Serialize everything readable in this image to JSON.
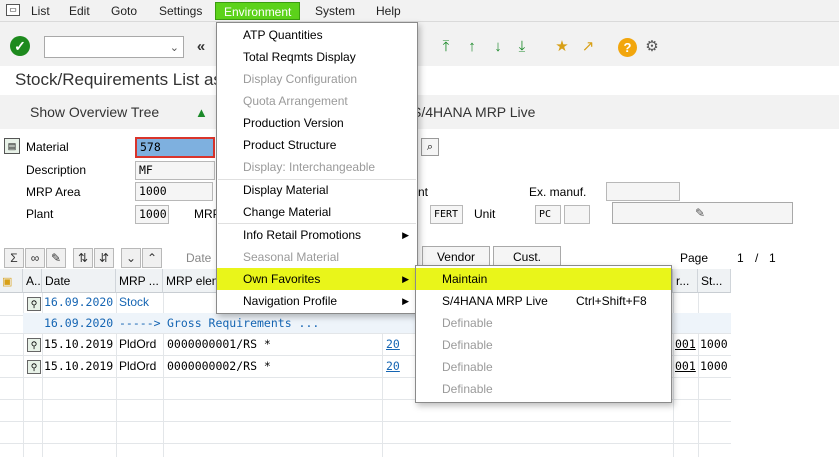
{
  "menubar": {
    "items": [
      {
        "label": "List"
      },
      {
        "label": "Edit"
      },
      {
        "label": "Goto"
      },
      {
        "label": "Settings"
      },
      {
        "label": "Environment"
      },
      {
        "label": "System"
      },
      {
        "label": "Help"
      }
    ]
  },
  "page": {
    "title": "Stock/Requirements List as",
    "app_buttons": [
      "Show Overview Tree",
      "S/4HANA MRP Live"
    ]
  },
  "form": {
    "material_label": "Material",
    "material_value": "578",
    "description_label": "Description",
    "description_value": "MF",
    "mrp_area_label": "MRP Area",
    "mrp_area_value": "1000",
    "plant_label": "Plant",
    "plant_value": "1000",
    "mrp_label": "MRP",
    "ex_manuf_label": "Ex. manuf.",
    "type_value": "FERT",
    "unit_label": "Unit",
    "unit_value": "PC",
    "nt_label": "nt"
  },
  "grid_toolbar": {
    "date_label": "Date",
    "vendor_btn": "Vendor",
    "cust_btn": "Cust.",
    "page_label": "Page",
    "page_current": "1",
    "page_sep": "/",
    "page_total": "1"
  },
  "grid": {
    "headers": [
      "A..",
      "Date",
      "MRP ...",
      "MRP elem",
      "r...",
      "St..."
    ],
    "rows": [
      {
        "date": "16.09.2020",
        "mrp": "Stock",
        "elem": "",
        "qty": "",
        "r": "",
        "st": ""
      },
      {
        "date": "16.09.2020",
        "mrp": "----->",
        "elem": "Gross Requirements ...",
        "qty": "",
        "r": "",
        "st": ""
      },
      {
        "date": "15.10.2019",
        "mrp": "PldOrd",
        "elem": "0000000001/RS  *",
        "qty": "20",
        "r": "001",
        "st": "1000"
      },
      {
        "date": "15.10.2019",
        "mrp": "PldOrd",
        "elem": "0000000002/RS  *",
        "qty": "20",
        "r": "001",
        "st": "1000"
      }
    ]
  },
  "env_menu": {
    "items": [
      {
        "label": "ATP Quantities",
        "disabled": false
      },
      {
        "label": "Total Reqmts Display",
        "disabled": false
      },
      {
        "label": "Display Configuration",
        "disabled": true
      },
      {
        "label": "Quota Arrangement",
        "disabled": true
      },
      {
        "label": "Production Version",
        "disabled": false
      },
      {
        "label": "Product Structure",
        "disabled": false
      },
      {
        "label": "Display: Interchangeable",
        "disabled": true
      },
      {
        "label": "Display Material",
        "disabled": false
      },
      {
        "label": "Change Material",
        "disabled": false
      },
      {
        "label": "Info Retail Promotions",
        "disabled": false
      },
      {
        "label": "Seasonal Material",
        "disabled": true
      },
      {
        "label": "Own Favorites",
        "disabled": false
      },
      {
        "label": "Navigation Profile",
        "disabled": false
      }
    ]
  },
  "fav_menu": {
    "items": [
      {
        "label": "Maintain",
        "shortcut": ""
      },
      {
        "label": "S/4HANA MRP Live",
        "shortcut": "Ctrl+Shift+F8"
      },
      {
        "label": "Definable",
        "shortcut": ""
      },
      {
        "label": "Definable",
        "shortcut": ""
      },
      {
        "label": "Definable",
        "shortcut": ""
      },
      {
        "label": "Definable",
        "shortcut": ""
      }
    ]
  },
  "colors": {
    "menu_active": "#5cd21a",
    "highlight": "#e9f51a",
    "link_blue": "#1565b3"
  }
}
